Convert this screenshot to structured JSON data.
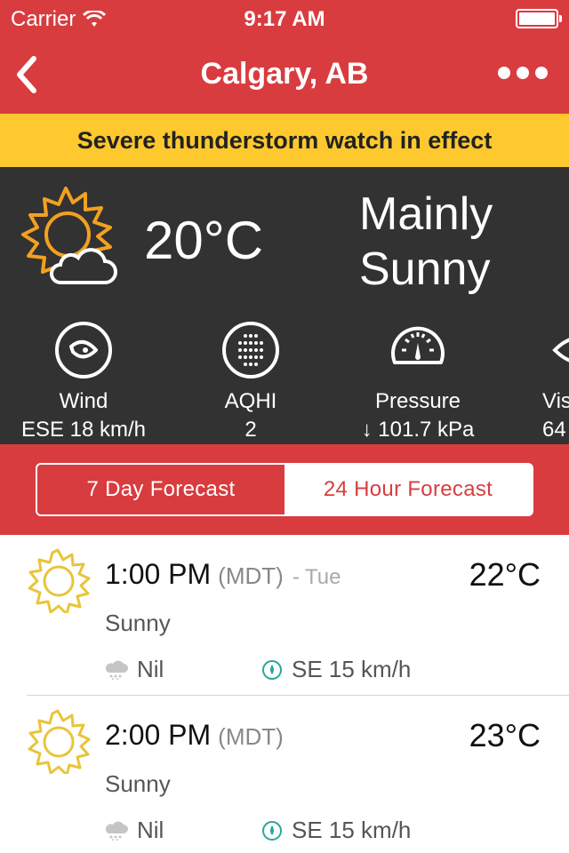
{
  "status_bar": {
    "carrier": "Carrier",
    "time": "9:17 AM"
  },
  "nav": {
    "title": "Calgary, AB",
    "back_icon": "chevron-left-icon",
    "more_icon": "ellipsis-icon"
  },
  "alert": {
    "text": "Severe thunderstorm watch in effect",
    "color": "#fdc92e"
  },
  "current": {
    "icon": "sun-cloud-icon",
    "temperature": "20°C",
    "condition_line1": "Mainly",
    "condition_line2": "Sunny",
    "metrics": [
      {
        "label": "Wind",
        "value": "ESE 18 km/h",
        "icon": "wind-icon"
      },
      {
        "label": "AQHI",
        "value": "2",
        "icon": "aqhi-icon"
      },
      {
        "label": "Pressure",
        "value": "↓ 101.7 kPa",
        "icon": "gauge-icon"
      },
      {
        "label": "Vis",
        "value": "64",
        "icon": "eye-icon"
      }
    ]
  },
  "tabs": [
    {
      "label": "7 Day Forecast",
      "active": true
    },
    {
      "label": "24 Hour Forecast",
      "active": false
    }
  ],
  "hourly": [
    {
      "time": "1:00 PM",
      "tz": "(MDT)",
      "day": "- Tue",
      "temp": "22°C",
      "condition": "Sunny",
      "precip": "Nil",
      "wind": "SE 15 km/h",
      "icon": "sun-icon"
    },
    {
      "time": "2:00 PM",
      "tz": "(MDT)",
      "day": "",
      "temp": "23°C",
      "condition": "Sunny",
      "precip": "Nil",
      "wind": "SE 15 km/h",
      "icon": "sun-icon"
    }
  ],
  "colors": {
    "brand_red": "#d83c3f",
    "dark_panel": "#323232",
    "sun_orange": "#f2a11f",
    "sun_yellow": "#e8c53a"
  }
}
